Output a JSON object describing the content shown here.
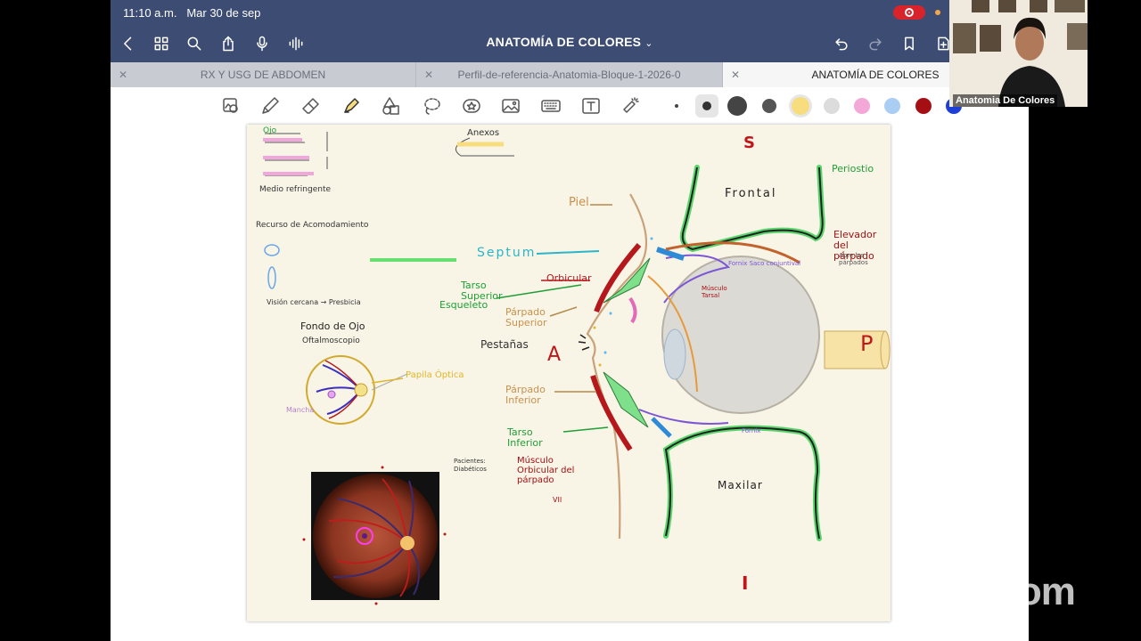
{
  "status_bar": {
    "time": "11:10 a.m.",
    "date": "Mar 30 de sep"
  },
  "title_bar": {
    "title": "ANATOMÍA DE COLORES",
    "icons": [
      "back-icon",
      "grid-icon",
      "search-icon",
      "share-icon",
      "microphone-icon",
      "waveform-icon",
      "undo-icon",
      "redo-icon",
      "bookmark-icon",
      "add-page-icon"
    ]
  },
  "tabs": [
    {
      "label": "RX Y USG DE ABDOMEN",
      "active": false
    },
    {
      "label": "Perfil-de-referencia-Anatomia-Bloque-1-2026-0",
      "active": false
    },
    {
      "label": "ANATOMÍA DE COLORES",
      "active": true
    }
  ],
  "toolbar": {
    "tools": [
      "lasso-image-icon",
      "pen-icon",
      "eraser-icon",
      "highlighter-icon",
      "shapes-icon",
      "lasso-icon",
      "sticker-icon",
      "image-icon",
      "keyboard-icon",
      "text-icon",
      "laser-pointer-icon"
    ],
    "colors": [
      "#444444",
      "#333333",
      "#555555",
      "#f7dd7e",
      "#dcdcdc",
      "#f3a8d8",
      "#aacdf3",
      "#a50f13",
      "#1d3fd6"
    ]
  },
  "drawing": {
    "labels": {
      "superior": "S",
      "inferior": "I",
      "anterior": "A",
      "posterior": "P",
      "frontal": "Frontal",
      "maxilar": "Maxilar",
      "periostio": "Periostio",
      "elevador": "Elevador del párpado",
      "elevador_note": "Abre los párpados",
      "piel": "Piel",
      "septum": "Septum",
      "orbicular": "Orbicular",
      "tarso_superior": "Tarso Superior",
      "esqueleto": "Esqueleto",
      "parpado_superior": "Párpado Superior",
      "pestanas": "Pestañas",
      "parpado_inferior": "Párpado Inferior",
      "tarso_inferior": "Tarso Inferior",
      "musculo_orbicular": "Músculo Orbicular del párpado",
      "vii": "VII",
      "fornix_sup": "Fornix Saco conjuntival",
      "fornix_inf": "Fornix",
      "musculo_tarsal": "Músculo Tarsal",
      "anexos": "Anexos",
      "fondo_ojo": "Fondo de Ojo",
      "oftalmoscopio": "Oftalmoscopio",
      "papila": "Papila Óptica",
      "mancha": "Mancha",
      "medio": "Medio refringente",
      "recurso": "Recurso de Acomodamiento",
      "vision": "Visión cercana → Presbicia",
      "pacientes": "Pacientes: Diabéticos",
      "ojo": "Ojo"
    }
  }
}
